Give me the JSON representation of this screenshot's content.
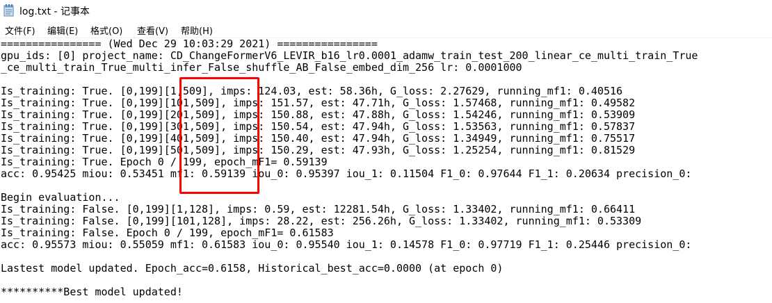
{
  "window": {
    "title": "log.txt - 记事本",
    "app_icon": "notepad-icon"
  },
  "menu": {
    "file": "文件(F)",
    "edit": "编辑(E)",
    "format": "格式(O)",
    "view": "查看(V)",
    "help": "帮助(H)"
  },
  "editor": {
    "lines": [
      "================ (Wed Dec 29 10:03:29 2021) ================",
      "gpu_ids: [0] project_name: CD_ChangeFormerV6_LEVIR_b16_lr0.0001_adamw_train_test_200_linear_ce_multi_train_True",
      "_ce_multi_train_True_multi_infer_False_shuffle_AB_False_embed_dim_256 lr: 0.0001000",
      "",
      "Is_training: True. [0,199][1,509], imps: 124.03, est: 58.36h, G_loss: 2.27629, running_mf1: 0.40516",
      "Is_training: True. [0,199][101,509], imps: 151.57, est: 47.71h, G_loss: 1.57468, running_mf1: 0.49582",
      "Is_training: True. [0,199][201,509], imps: 150.88, est: 47.88h, G_loss: 1.54246, running_mf1: 0.53909",
      "Is_training: True. [0,199][301,509], imps: 150.54, est: 47.94h, G_loss: 1.53563, running_mf1: 0.57837",
      "Is_training: True. [0,199][401,509], imps: 150.40, est: 47.94h, G_loss: 1.34949, running_mf1: 0.75517",
      "Is_training: True. [0,199][501,509], imps: 150.29, est: 47.93h, G_loss: 1.25254, running_mf1: 0.81529",
      "Is_training: True. Epoch 0 / 199, epoch_mF1= 0.59139",
      "acc: 0.95425 miou: 0.53451 mf1: 0.59139 iou_0: 0.95397 iou_1: 0.11504 F1_0: 0.97644 F1_1: 0.20634 precision_0:",
      "",
      "Begin evaluation...",
      "Is_training: False. [0,199][1,128], imps: 0.59, est: 12281.54h, G_loss: 1.33402, running_mf1: 0.66411",
      "Is_training: False. [0,199][101,128], imps: 28.22, est: 256.26h, G_loss: 1.33402, running_mf1: 0.53309",
      "Is_training: False. Epoch 0 / 199, epoch_mF1= 0.61583",
      "acc: 0.95573 miou: 0.55059 mf1: 0.61583 iou_0: 0.95540 iou_1: 0.14578 F1_0: 0.97719 F1_1: 0.25446 precision_0:",
      "",
      "Lastest model updated. Epoch_acc=0.6158, Historical_best_acc=0.0000 (at epoch 0)",
      "",
      "**********Best model updated!"
    ]
  },
  "colors": {
    "highlight": "#ff0000",
    "text": "#000000",
    "background": "#ffffff"
  }
}
